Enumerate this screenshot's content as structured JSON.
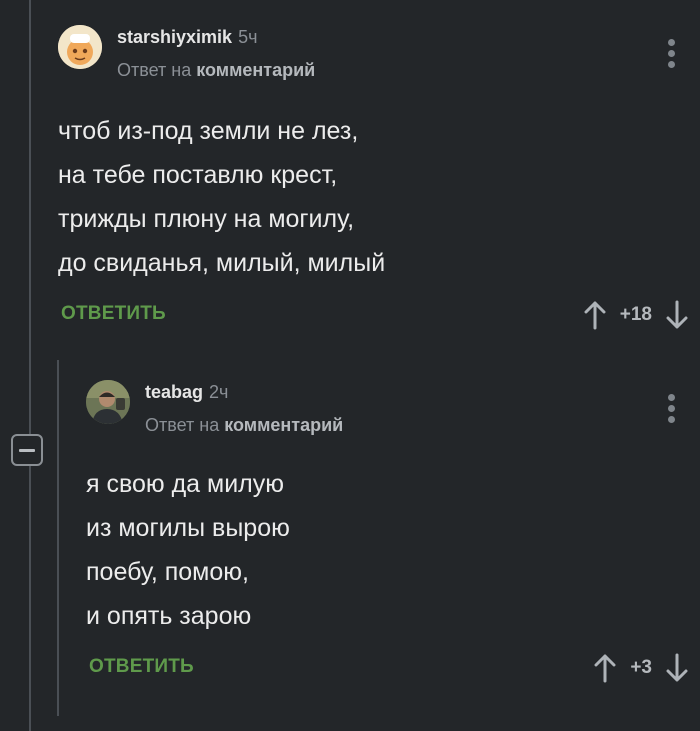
{
  "comments": [
    {
      "username": "starshiyximik",
      "age": "5ч",
      "reply_prefix": "Ответ на",
      "reply_link": "комментарий",
      "lines": [
        "чтоб из-под земли не лез,",
        "на тебе поставлю крест,",
        "трижды плюну на могилу,",
        "до свиданья, милый, милый"
      ],
      "reply_label": "ОТВЕТИТЬ",
      "score": "+18",
      "avatar_icon": "cartoon-avatar"
    },
    {
      "username": "teabag",
      "age": "2ч",
      "reply_prefix": "Ответ на",
      "reply_link": "комментарий",
      "lines": [
        "я свою да милую",
        "из могилы вырою",
        "поебу, помою,",
        "и опять зарою"
      ],
      "reply_label": "ОТВЕТИТЬ",
      "score": "+3",
      "avatar_icon": "photo-avatar"
    }
  ],
  "colors": {
    "background": "#232629",
    "accent_green": "#5f9a4b",
    "muted": "#8b9096"
  },
  "icons": {
    "more": "more-vertical-icon",
    "upvote": "arrow-up-icon",
    "downvote": "arrow-down-icon",
    "collapse": "minus-collapse-icon"
  }
}
